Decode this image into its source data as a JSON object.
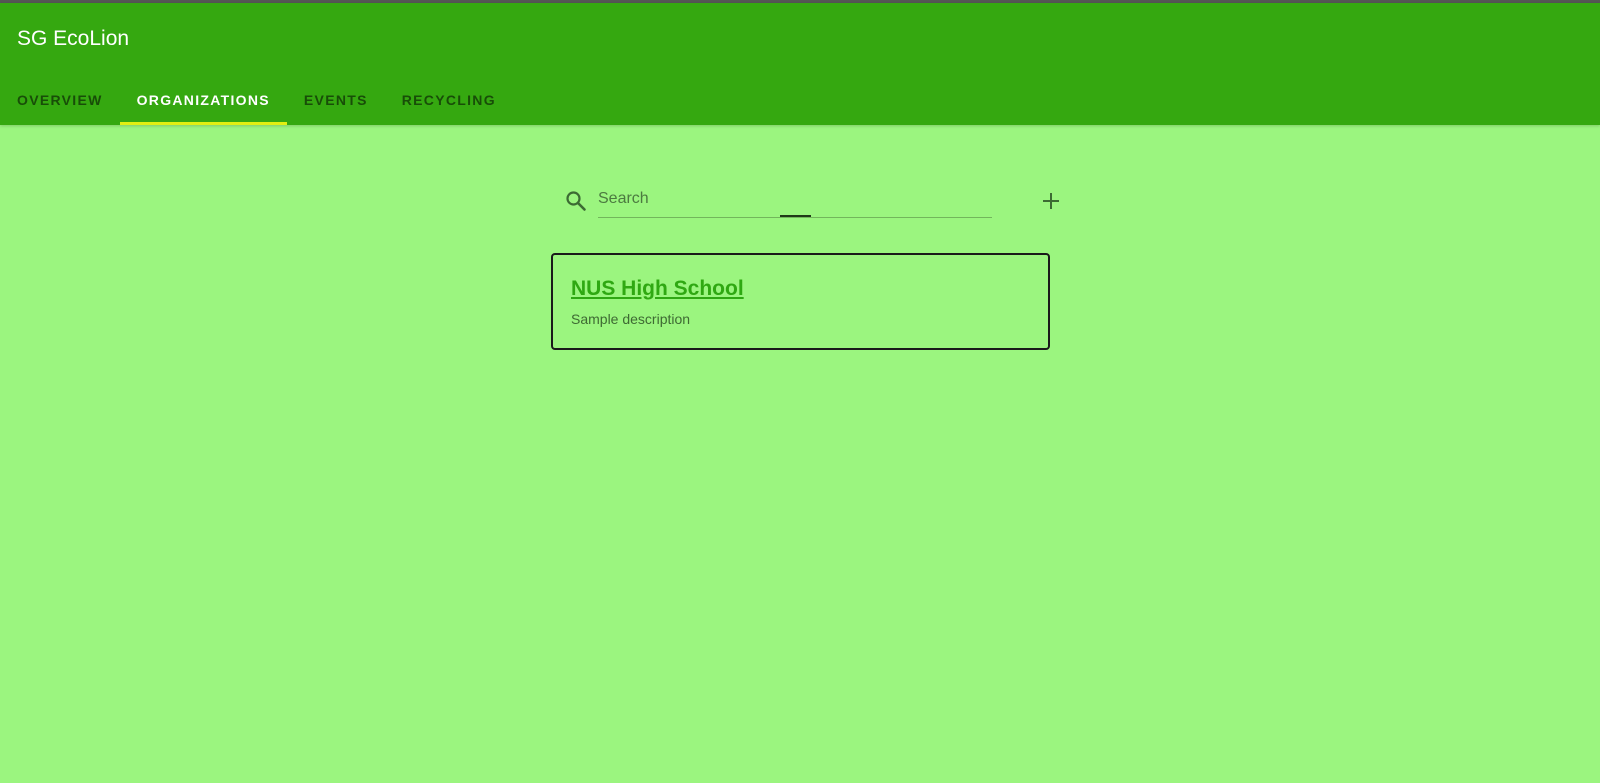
{
  "app": {
    "title": "SG EcoLion"
  },
  "tabs": [
    {
      "label": "OVERVIEW",
      "active": false
    },
    {
      "label": "ORGANIZATIONS",
      "active": true
    },
    {
      "label": "EVENTS",
      "active": false
    },
    {
      "label": "RECYCLING",
      "active": false
    }
  ],
  "search": {
    "placeholder": "Search",
    "value": "",
    "icon": "search-icon"
  },
  "add_button": {
    "icon": "plus-icon"
  },
  "organizations": [
    {
      "name": "NUS High School",
      "description": "Sample description"
    }
  ],
  "colors": {
    "appbar": "#35a810",
    "background": "#9bf57f",
    "tab_indicator": "#e2ef12",
    "link": "#2fa812"
  }
}
